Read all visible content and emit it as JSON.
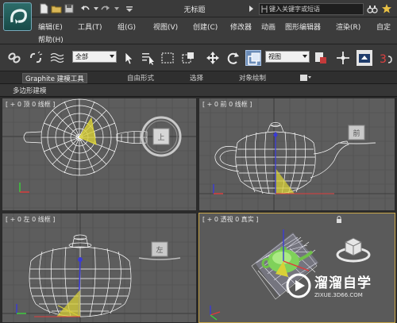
{
  "window": {
    "title": "无标题",
    "search_placeholder": "键入关键字或短语"
  },
  "menu": {
    "items": [
      "编辑(E)",
      "工具(T)",
      "组(G)",
      "视图(V)",
      "创建(C)",
      "修改器",
      "动画",
      "图形编辑器",
      "渲染(R)",
      "自定",
      "帮助(H)"
    ]
  },
  "toolbar": {
    "selection_filter": "全部",
    "reference_coord": "视图"
  },
  "ribbon": {
    "tabs": [
      "Graphite 建模工具",
      "自由形式",
      "选择",
      "对象绘制"
    ],
    "active_tab": 0,
    "panel_label": "多边形建模"
  },
  "viewports": {
    "top": "[ + 0 顶 0 线框 ]",
    "front": "[ + 0 前 0 线框 ]",
    "left": "[ + 0 左 0 线框 ]",
    "perspective": "[ + 0 透视 0 真实 ]"
  },
  "viewcube": {
    "top": "上",
    "front": "前",
    "left": "左"
  },
  "watermark": {
    "brand": "溜溜自学",
    "url": "ZIXUE.3D66.COM"
  },
  "colors": {
    "wire": "#ffffff",
    "yellow": "#d8d038",
    "accent": "#c8a64a"
  }
}
